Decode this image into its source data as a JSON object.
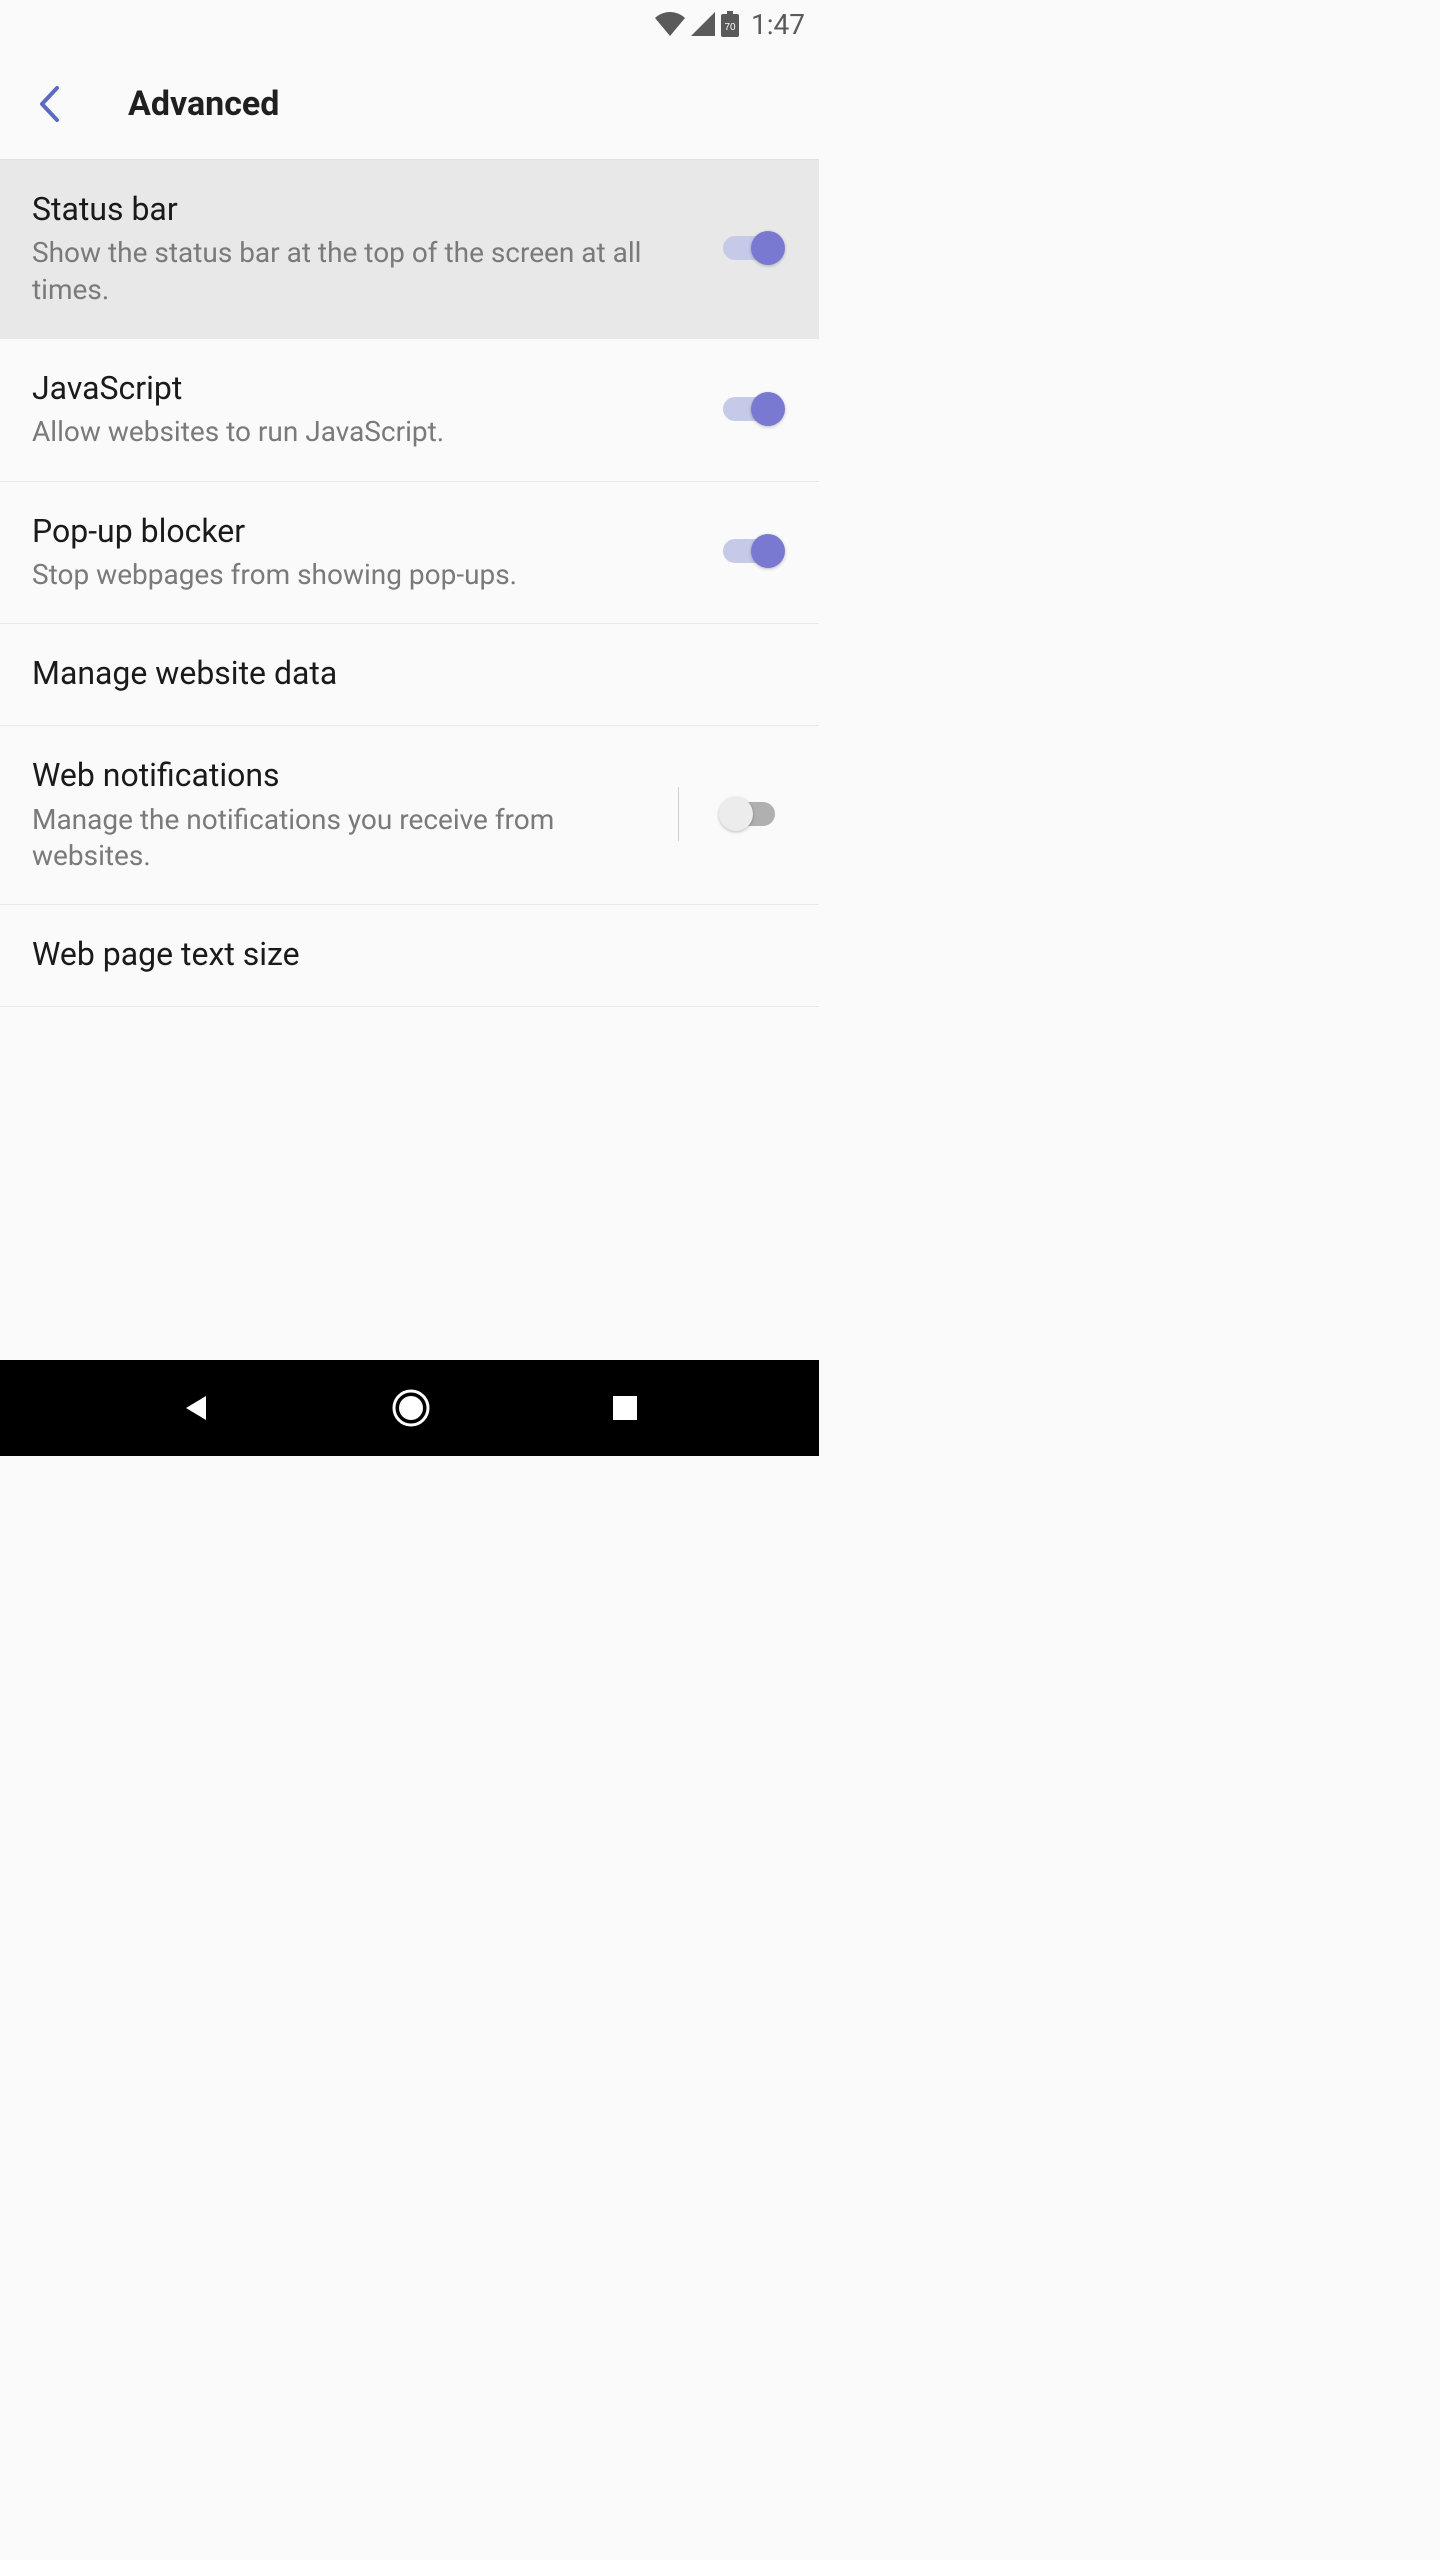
{
  "statusbar": {
    "battery_level": "70",
    "time": "1:47"
  },
  "appbar": {
    "title": "Advanced"
  },
  "settings": {
    "status_bar": {
      "title": "Status bar",
      "subtitle": "Show the status bar at the top of the screen at all times.",
      "enabled": true
    },
    "javascript": {
      "title": "JavaScript",
      "subtitle": "Allow websites to run JavaScript.",
      "enabled": true
    },
    "popup_blocker": {
      "title": "Pop-up blocker",
      "subtitle": "Stop webpages from showing pop-ups.",
      "enabled": true
    },
    "manage_website_data": {
      "title": "Manage website data"
    },
    "web_notifications": {
      "title": "Web notifications",
      "subtitle": "Manage the notifications you receive from websites.",
      "enabled": false
    },
    "web_page_text_size": {
      "title": "Web page text size"
    }
  }
}
